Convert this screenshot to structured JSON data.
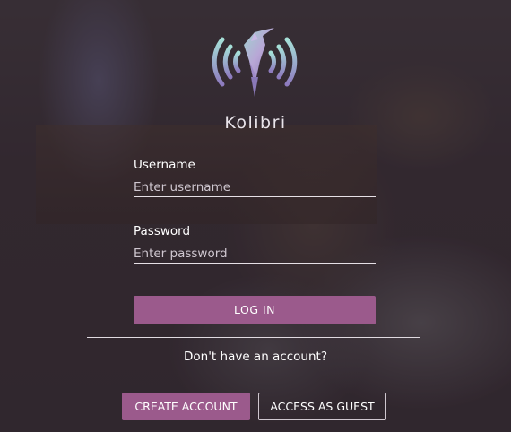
{
  "app": {
    "name": "Kolibri",
    "logo_icon": "kolibri-hummingbird-icon"
  },
  "form": {
    "username_label": "Username",
    "username_placeholder": "Enter username",
    "password_label": "Password",
    "password_placeholder": "Enter password",
    "login_label": "LOG IN"
  },
  "signup": {
    "prompt": "Don't have an account?",
    "create_account_label": "CREATE ACCOUNT",
    "guest_label": "ACCESS AS GUEST"
  },
  "colors": {
    "accent": "#9b5a8c",
    "text": "#ffffff"
  }
}
